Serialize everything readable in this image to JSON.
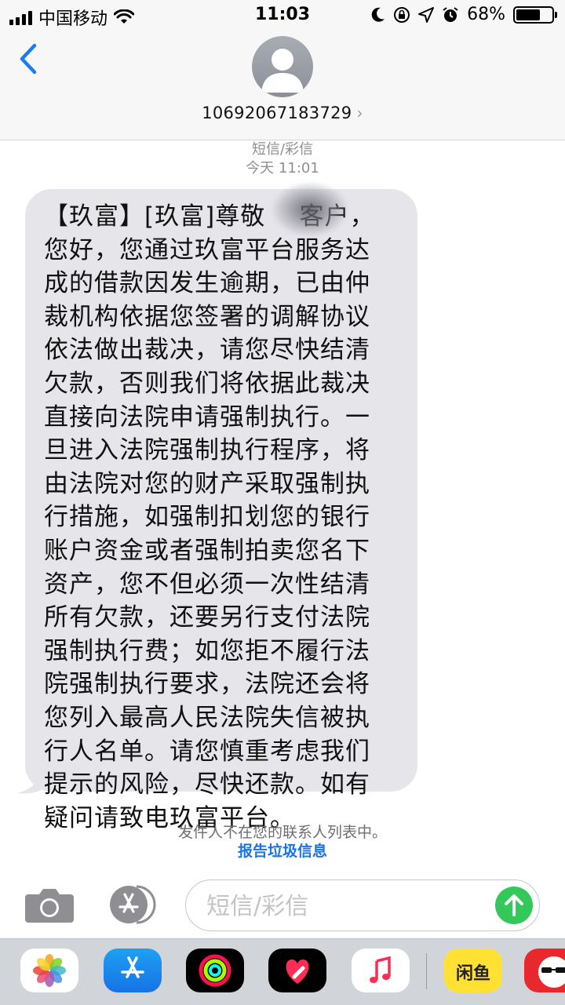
{
  "status_bar": {
    "carrier": "中国移动",
    "time": "11:03",
    "battery_percent": "68%",
    "battery_level": 0.68
  },
  "header": {
    "contact_number": "10692067183729",
    "chevron": "›"
  },
  "thread": {
    "message_type": "短信/彩信",
    "timestamp": "今天 11:01",
    "message_text": "【玖富】[玖富]尊敬    客户，\n您好，您通过玖富平台服务达\n成的借款因发生逾期，已由仲\n裁机构依据您签署的调解协议\n依法做出裁决，请您尽快结清\n欠款，否则我们将依据此裁决\n直接向法院申请强制执行。一\n旦进入法院强制执行程序，将\n由法院对您的财产采取强制执\n行措施，如强制扣划您的银行\n账户资金或者强制拍卖您名下\n资产，您不但必须一次性结清\n所有欠款，还要另行支付法院\n强制执行费；如您拒不履行法\n院强制执行要求，法院还会将\n您列入最高人民法院失信被执\n行人名单。请您慎重考虑我们\n提示的风险，尽快还款。如有\n疑问请致电玖富平台。",
    "sender_notice": "发件人不在您的联系人列表中。",
    "report_link": "报告垃圾信息"
  },
  "composer": {
    "placeholder": "短信/彩信",
    "value": ""
  },
  "app_drawer": {
    "apps": [
      "photos-app-icon",
      "app-store-icon",
      "activity-app-icon",
      "digital-touch-icon",
      "music-app-icon",
      "xianyu-app-icon",
      "sticker-app-icon"
    ],
    "xianyu_label": "闲鱼"
  },
  "colors": {
    "bubble": "#e5e5ea",
    "link": "#1a73e8",
    "send": "#34c759",
    "back": "#1a7cf5"
  }
}
